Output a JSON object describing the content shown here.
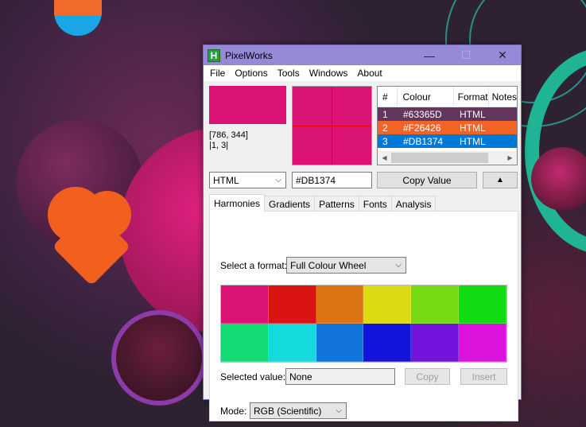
{
  "window": {
    "title": "PixelWorks",
    "icon_letter": "H"
  },
  "menu": [
    "File",
    "Options",
    "Tools",
    "Windows",
    "About"
  ],
  "current_colour": "#DB1374",
  "coords": {
    "position": "[786, 344]",
    "zoom_pos": "|1, 3|"
  },
  "format_select": "HTML",
  "hex_value": "#DB1374",
  "buttons": {
    "copy_value": "Copy Value",
    "up": "▲"
  },
  "history": {
    "columns": [
      "#",
      "Colour",
      "Format",
      "Notes"
    ],
    "rows": [
      {
        "num": "1",
        "colour": "#63365D",
        "format": "HTML",
        "bg": "#63365D"
      },
      {
        "num": "2",
        "colour": "#F26426",
        "format": "HTML",
        "bg": "#F26426"
      },
      {
        "num": "3",
        "colour": "#DB1374",
        "format": "HTML",
        "bg": "#0078D7"
      }
    ]
  },
  "tabs": [
    "Harmonies",
    "Gradients",
    "Patterns",
    "Fonts",
    "Analysis"
  ],
  "harmonies": {
    "select_format_label": "Select a format:",
    "select_format_value": "Full Colour Wheel",
    "wheel_colours": [
      "#DB1374",
      "#DB1313",
      "#DB7413",
      "#DBDB13",
      "#74DB13",
      "#13DB13",
      "#13DB74",
      "#13DBDB",
      "#1374DB",
      "#1313DB",
      "#7413DB",
      "#DB13DB"
    ],
    "selected_value_label": "Selected value:",
    "selected_value": "None",
    "copy_label": "Copy",
    "insert_label": "Insert",
    "mode_label": "Mode:",
    "mode_value": "RGB (Scientific)"
  }
}
